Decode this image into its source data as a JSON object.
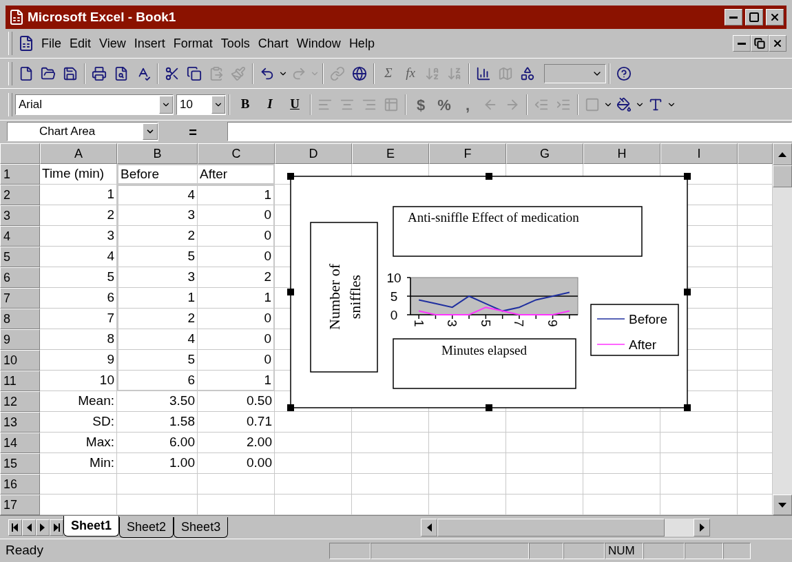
{
  "window": {
    "title": "Microsoft Excel - Book1"
  },
  "menu": [
    "File",
    "Edit",
    "View",
    "Insert",
    "Format",
    "Tools",
    "Chart",
    "Window",
    "Help"
  ],
  "toolbar_texts": [
    {
      "label": "Σ",
      "disabled": true
    },
    {
      "label": "fx",
      "disabled": true
    }
  ],
  "formatting": {
    "font": "Arial",
    "size": "10",
    "text_buttons": [
      {
        "label": "B",
        "disabled": false
      },
      {
        "label": "I",
        "disabled": false
      },
      {
        "label": "U",
        "disabled": false
      }
    ],
    "number_buttons": [
      {
        "label": "$",
        "disabled": true
      },
      {
        "label": "%",
        "disabled": true
      },
      {
        "label": ",",
        "disabled": true
      }
    ]
  },
  "name_box": "Chart Area",
  "formula_button": "=",
  "columns": [
    "A",
    "B",
    "C",
    "D",
    "E",
    "F",
    "G",
    "H",
    "I"
  ],
  "rows": [
    {
      "header": "1",
      "kind": "heading",
      "cells": [
        "Time (min)",
        "Before",
        "After"
      ]
    },
    {
      "header": "2",
      "kind": "data",
      "cells": [
        "1",
        "4",
        "1"
      ]
    },
    {
      "header": "3",
      "kind": "data",
      "cells": [
        "2",
        "3",
        "0"
      ]
    },
    {
      "header": "4",
      "kind": "data",
      "cells": [
        "3",
        "2",
        "0"
      ]
    },
    {
      "header": "5",
      "kind": "data",
      "cells": [
        "4",
        "5",
        "0"
      ]
    },
    {
      "header": "6",
      "kind": "data",
      "cells": [
        "5",
        "3",
        "2"
      ]
    },
    {
      "header": "7",
      "kind": "data",
      "cells": [
        "6",
        "1",
        "1"
      ]
    },
    {
      "header": "8",
      "kind": "data",
      "cells": [
        "7",
        "2",
        "0"
      ]
    },
    {
      "header": "9",
      "kind": "data",
      "cells": [
        "8",
        "4",
        "0"
      ]
    },
    {
      "header": "10",
      "kind": "data",
      "cells": [
        "9",
        "5",
        "0"
      ]
    },
    {
      "header": "11",
      "kind": "data",
      "cells": [
        "10",
        "6",
        "1"
      ]
    },
    {
      "header": "12",
      "kind": "data",
      "cells": [
        "Mean:",
        "3.50",
        "0.50"
      ]
    },
    {
      "header": "13",
      "kind": "data",
      "cells": [
        "SD:",
        "1.58",
        "0.71"
      ]
    },
    {
      "header": "14",
      "kind": "data",
      "cells": [
        "Max:",
        "6.00",
        "2.00"
      ]
    },
    {
      "header": "15",
      "kind": "data",
      "cells": [
        "Min:",
        "1.00",
        "0.00"
      ]
    },
    {
      "header": "16",
      "cells": []
    },
    {
      "header": "17",
      "cells": []
    }
  ],
  "chart": {
    "selected": true,
    "chart_data": {
      "type": "line",
      "legend": true,
      "xlim": [
        0.5,
        10.5
      ],
      "title": "Anti-sniffle Effect of medication",
      "xlabel": "Minutes elapsed",
      "ylabel": "Number of sniffles",
      "x": [
        1,
        2,
        3,
        4,
        5,
        6,
        7,
        8,
        9,
        10
      ],
      "xticks": [
        1,
        3,
        5,
        7,
        9
      ],
      "yticks": [
        0,
        5,
        10
      ],
      "ylim": [
        0,
        10
      ],
      "series": [
        {
          "name": "Before",
          "color": "#1f2f9f",
          "values": [
            4,
            3,
            2,
            5,
            3,
            1,
            2,
            4,
            5,
            6
          ]
        },
        {
          "name": "After",
          "color": "#ff33ff",
          "values": [
            1,
            0,
            0,
            0,
            2,
            1,
            0,
            0,
            0,
            1
          ]
        }
      ]
    }
  },
  "sheet_tabs": [
    {
      "label": "Sheet1",
      "selected": true
    },
    {
      "label": "Sheet2",
      "selected": false
    },
    {
      "label": "Sheet3",
      "selected": false
    }
  ],
  "status": {
    "text": "Ready",
    "num": "NUM"
  }
}
